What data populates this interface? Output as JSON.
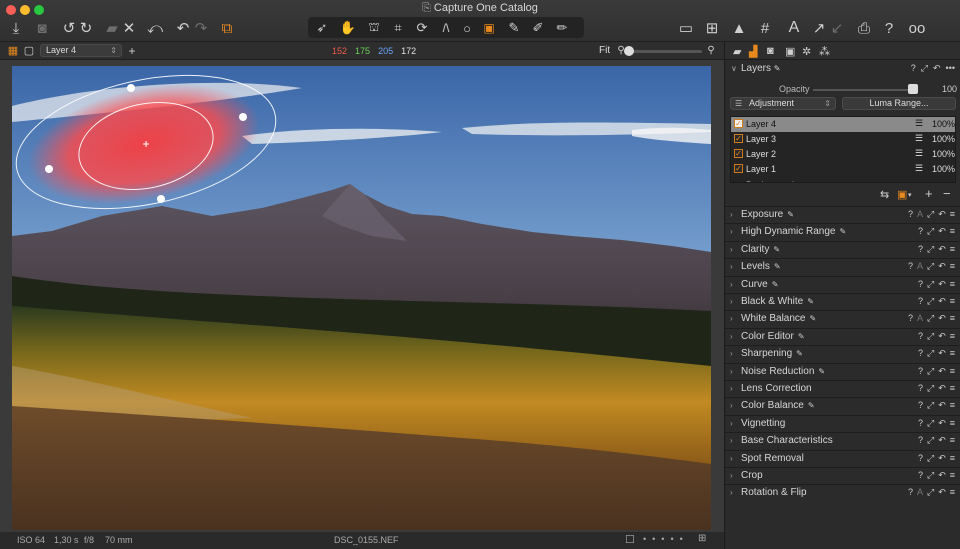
{
  "window": {
    "title": "Capture One Catalog"
  },
  "toolbar": {
    "icons": [
      "import-icon",
      "camera-icon",
      "rotate-left-icon",
      "rotate-right-icon",
      "folder-icon",
      "delete-icon",
      "undo-icon",
      "redo-icon",
      "copy-icon",
      "cursor-tools-icon",
      "export-icon",
      "settings-icon",
      "warning-icon",
      "grid-icon",
      "text-icon",
      "print-icon",
      "help-icon",
      "glasses-icon"
    ]
  },
  "subbar": {
    "layer_selected": "Layer 4",
    "rgb": {
      "r": "152",
      "g": "175",
      "b": "205",
      "l": "172"
    },
    "zoom_label": "Fit"
  },
  "status": {
    "iso": "ISO 64",
    "shutter": "1,30 s",
    "aperture": "f/8",
    "focal": "70 mm",
    "filename": "DSC_0155.NEF"
  },
  "panel": {
    "layers_title": "Layers",
    "opacity_label": "Opacity",
    "opacity_value": "100",
    "opacity_fraction": 1.0,
    "adjustment_label": "Adjustment",
    "luma_label": "Luma Range...",
    "layers": [
      {
        "name": "Layer 4",
        "pct": "100%",
        "selected": true
      },
      {
        "name": "Layer 3",
        "pct": "100%",
        "selected": false
      },
      {
        "name": "Layer 2",
        "pct": "100%",
        "selected": false
      },
      {
        "name": "Layer 1",
        "pct": "100%",
        "selected": false
      },
      {
        "name": "Background",
        "pct": "",
        "selected": false
      }
    ],
    "tools": [
      {
        "name": "Exposure",
        "pen": true,
        "a": true
      },
      {
        "name": "High Dynamic Range",
        "pen": true,
        "a": false
      },
      {
        "name": "Clarity",
        "pen": true,
        "a": false
      },
      {
        "name": "Levels",
        "pen": true,
        "a": true
      },
      {
        "name": "Curve",
        "pen": true,
        "a": false
      },
      {
        "name": "Black & White",
        "pen": true,
        "a": false
      },
      {
        "name": "White Balance",
        "pen": true,
        "a": true
      },
      {
        "name": "Color Editor",
        "pen": true,
        "a": false
      },
      {
        "name": "Sharpening",
        "pen": true,
        "a": false
      },
      {
        "name": "Noise Reduction",
        "pen": true,
        "a": false
      },
      {
        "name": "Lens Correction",
        "pen": false,
        "a": false
      },
      {
        "name": "Color Balance",
        "pen": true,
        "a": false
      },
      {
        "name": "Vignetting",
        "pen": false,
        "a": false
      },
      {
        "name": "Base Characteristics",
        "pen": false,
        "a": false
      },
      {
        "name": "Spot Removal",
        "pen": false,
        "a": false
      },
      {
        "name": "Crop",
        "pen": false,
        "a": false
      },
      {
        "name": "Rotation & Flip",
        "pen": false,
        "a": true
      }
    ]
  }
}
